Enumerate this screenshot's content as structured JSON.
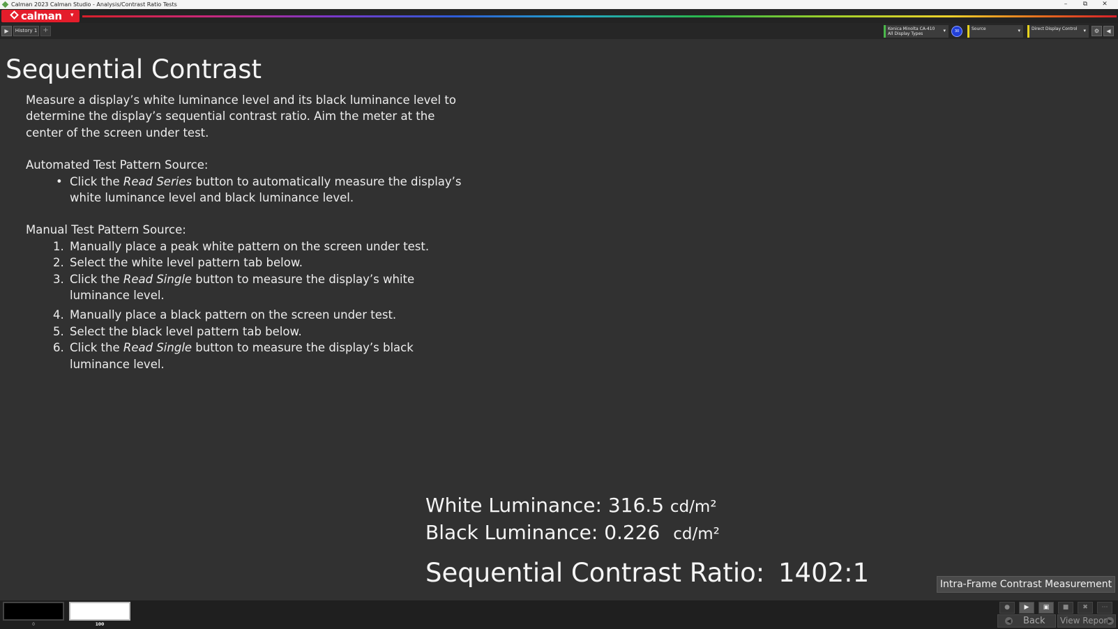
{
  "window": {
    "title": "Calman 2023 Calman Studio  - Analysis/Contrast Ratio Tests",
    "controls": {
      "minimize": "–",
      "restore": "⧉",
      "close": "✕"
    }
  },
  "brand": {
    "name": "calman",
    "caret": "▾"
  },
  "toolbar": {
    "play_icon": "▶",
    "history_tab": "History 1",
    "add_tab": "+",
    "meter": {
      "line1": "Konica Minolta CA-410",
      "line2": "All Display Types",
      "caret": "▾"
    },
    "meter_badge": "30",
    "source": {
      "label": "Source",
      "caret": "▾"
    },
    "display_control": {
      "label": "Direct Display Control",
      "caret": "▾"
    },
    "settings_icon": "⚙",
    "collapse_icon": "◀"
  },
  "page": {
    "title": "Sequential Contrast",
    "intro": "Measure a display’s white luminance level and its black luminance level to determine the display’s sequential contrast ratio. Aim the meter at the center of the screen under test.",
    "automated": {
      "heading": "Automated Test Pattern Source:",
      "bullet": "•",
      "item_pre": "Click the ",
      "item_em": "Read Series",
      "item_post": " button to automatically measure the display’s white luminance level and black luminance level."
    },
    "manual": {
      "heading": "Manual Test Pattern Source:",
      "steps": [
        {
          "n": "1.",
          "text": "Manually place a peak white pattern on the screen under test."
        },
        {
          "n": "2.",
          "text": "Select the white level pattern tab below."
        },
        {
          "n": "3.",
          "pre": "Click the ",
          "em": "Read Single",
          "post": " button to measure the display’s white luminance level."
        },
        {
          "n": "4.",
          "text": "Manually place a black pattern on the screen under test."
        },
        {
          "n": "5.",
          "text": "Select the black level pattern tab below."
        },
        {
          "n": "6.",
          "pre": "Click the ",
          "em": "Read Single",
          "post": " button to measure the display’s black luminance level."
        }
      ]
    }
  },
  "results": {
    "white_label": "White Luminance:",
    "white_value": "316.5",
    "black_label": "Black Luminance:",
    "black_value": "0.226",
    "unit": "cd/m²",
    "ratio_label": "Sequential Contrast Ratio:",
    "ratio_value": "1402:1"
  },
  "intra_button": "Intra-Frame Contrast Measurement",
  "patterns": [
    {
      "label": "0",
      "color": "#000000"
    },
    {
      "label": "100",
      "color": "#ffffff"
    }
  ],
  "controls": {
    "record_icon": "●",
    "play_icon": "▶",
    "save_icon": "▣",
    "stop_icon": "■",
    "delete_icon": "✖",
    "more_icon": "⋯",
    "back_label": "Back",
    "back_icon": "◀",
    "report_label": "View Report",
    "report_icon": "▶"
  },
  "colors": {
    "background": "#313131",
    "brand_red": "#e41d2b",
    "meter_accent": "#4ab84a",
    "source_accent": "#e6d21e",
    "badge_blue": "#2140d8"
  }
}
